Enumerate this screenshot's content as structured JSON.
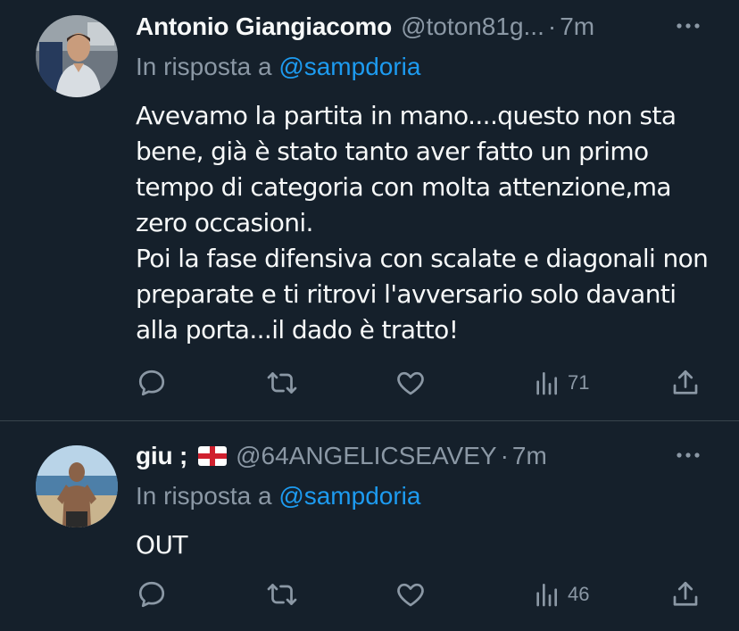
{
  "tweets": [
    {
      "name": "Antonio Giangiacomo",
      "flag": "",
      "handle": "@toton81g...",
      "dot": "·",
      "time": "7m",
      "reply_prefix": "In risposta a ",
      "reply_mention": "@sampdoria",
      "text": "Avevamo la partita in mano....questo non sta bene, già è stato tanto aver fatto un primo tempo di categoria con molta attenzione,ma zero occasioni.\nPoi la fase difensiva con scalate e diagonali non preparate e ti ritrovi l'avversario solo davanti alla porta...il dado è tratto!",
      "views": "71"
    },
    {
      "name": "giu ;",
      "flag": "england-flag-icon",
      "handle": "@64ANGELICSEAVEY",
      "dot": "·",
      "time": "7m",
      "reply_prefix": "In risposta a ",
      "reply_mention": "@sampdoria",
      "text": "OUT",
      "views": "46"
    }
  ],
  "colors": {
    "background": "#15202b",
    "text": "#f7f9f9",
    "secondary": "#8b98a5",
    "accent": "#1d9bf0",
    "divider": "#38444d"
  },
  "icons": {
    "more": "more-icon",
    "reply": "reply-icon",
    "retweet": "retweet-icon",
    "like": "heart-icon",
    "views": "views-icon",
    "share": "share-icon"
  }
}
